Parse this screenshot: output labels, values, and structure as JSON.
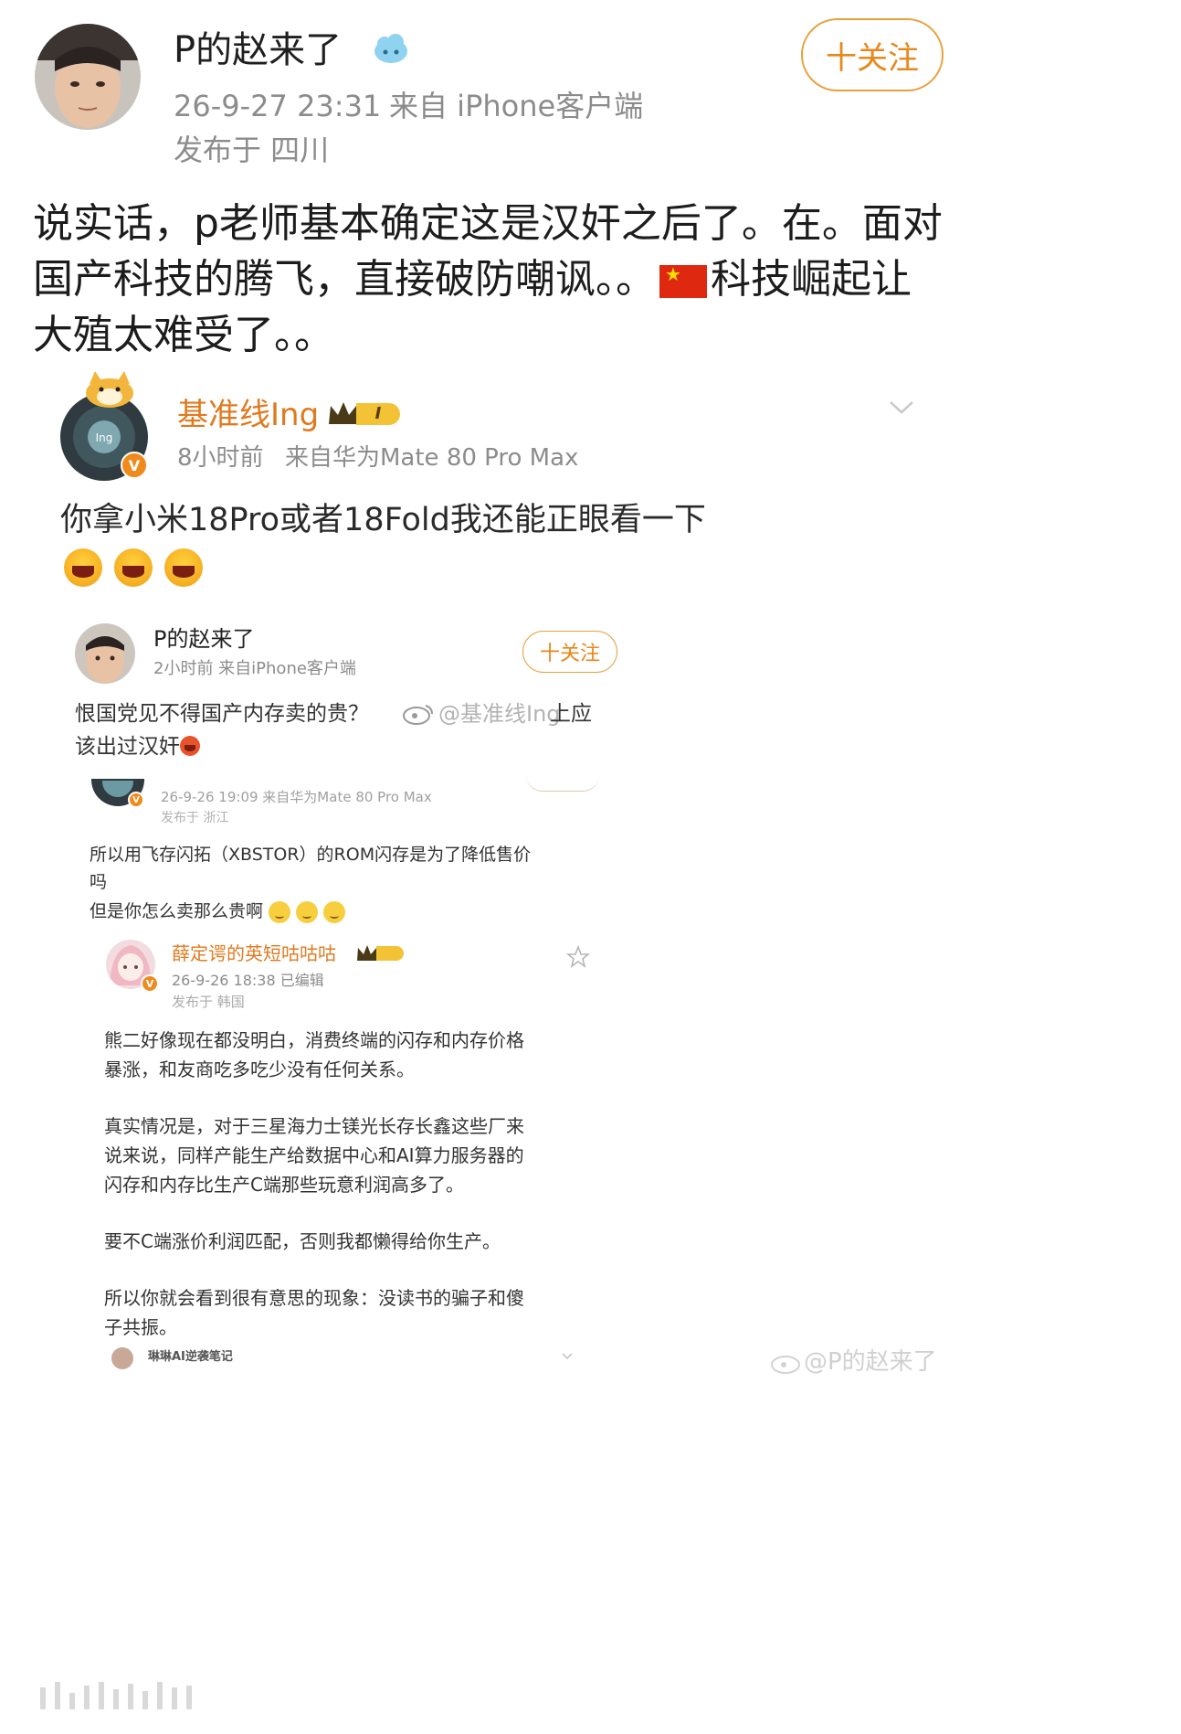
{
  "post": {
    "author_name": "P的赵来了",
    "timestamp": "26-9-27 23:31",
    "source": "来自 iPhone客户端",
    "location": "发布于 四川",
    "follow_label": "十关注",
    "body_part1": "说实话，p老师基本确定这是汉奸之后了。在。面对国产科技的腾飞，直接破防嘲讽。。",
    "body_part2": "科技崛起让大殖太难受了。。"
  },
  "quoted": {
    "author_name": "基准线Ing",
    "level_badge": "I",
    "time": "8小时前",
    "source": "来自华为Mate 80 Pro Max",
    "text": "你拿小米18Pro或者18Fold我还能正眼看一下"
  },
  "inner": {
    "author_name": "P的赵来了",
    "time_source": "2小时前 来自iPhone客户端",
    "follow_label": "十关注",
    "text_line1": "恨国党见不得国产内存卖的贵？",
    "text_line1_tail": "上应",
    "text_line2": "该出过汉奸",
    "watermark": "@基准线Ing",
    "nested_meta1": "26-9-26 19:09 来自华为Mate 80 Pro Max",
    "nested_meta2": "发布于 浙江",
    "nested_text1": "所以用飞存闪拓（XBSTOR）的ROM闪存是为了降低售价",
    "nested_text2": "吗",
    "nested_text3": "但是你怎么卖那么贵啊",
    "reply_author": "薛定谔的英短咕咕咕",
    "reply_meta1": "26-9-26 18:38 已编辑",
    "reply_meta2": "发布于 韩国",
    "reply_p1_l1": "熊二好像现在都没明白，消费终端的闪存和内存价格",
    "reply_p1_l2": "暴涨，和友商吃多吃少没有任何关系。",
    "reply_p2_l1": "真实情况是，对于三星海力士镁光长存长鑫这些厂来",
    "reply_p2_l2": "说来说，同样产能生产给数据中心和AI算力服务器的",
    "reply_p2_l3": "闪存和内存比生产C端那些玩意利润高多了。",
    "reply_p3": "要不C端涨价利润匹配，否则我都懒得给你生产。",
    "reply_p4_l1": "所以你就会看到很有意思的现象：没读书的骗子和傻",
    "reply_p4_l2": "子共振。",
    "footer_author": "琳琳AI逆袭笔记"
  },
  "image_watermark": "@P的赵来了",
  "colors": {
    "accent_orange": "#e8871a",
    "quoted_name": "#e07a1f",
    "gray_text": "#8c8c8c"
  }
}
